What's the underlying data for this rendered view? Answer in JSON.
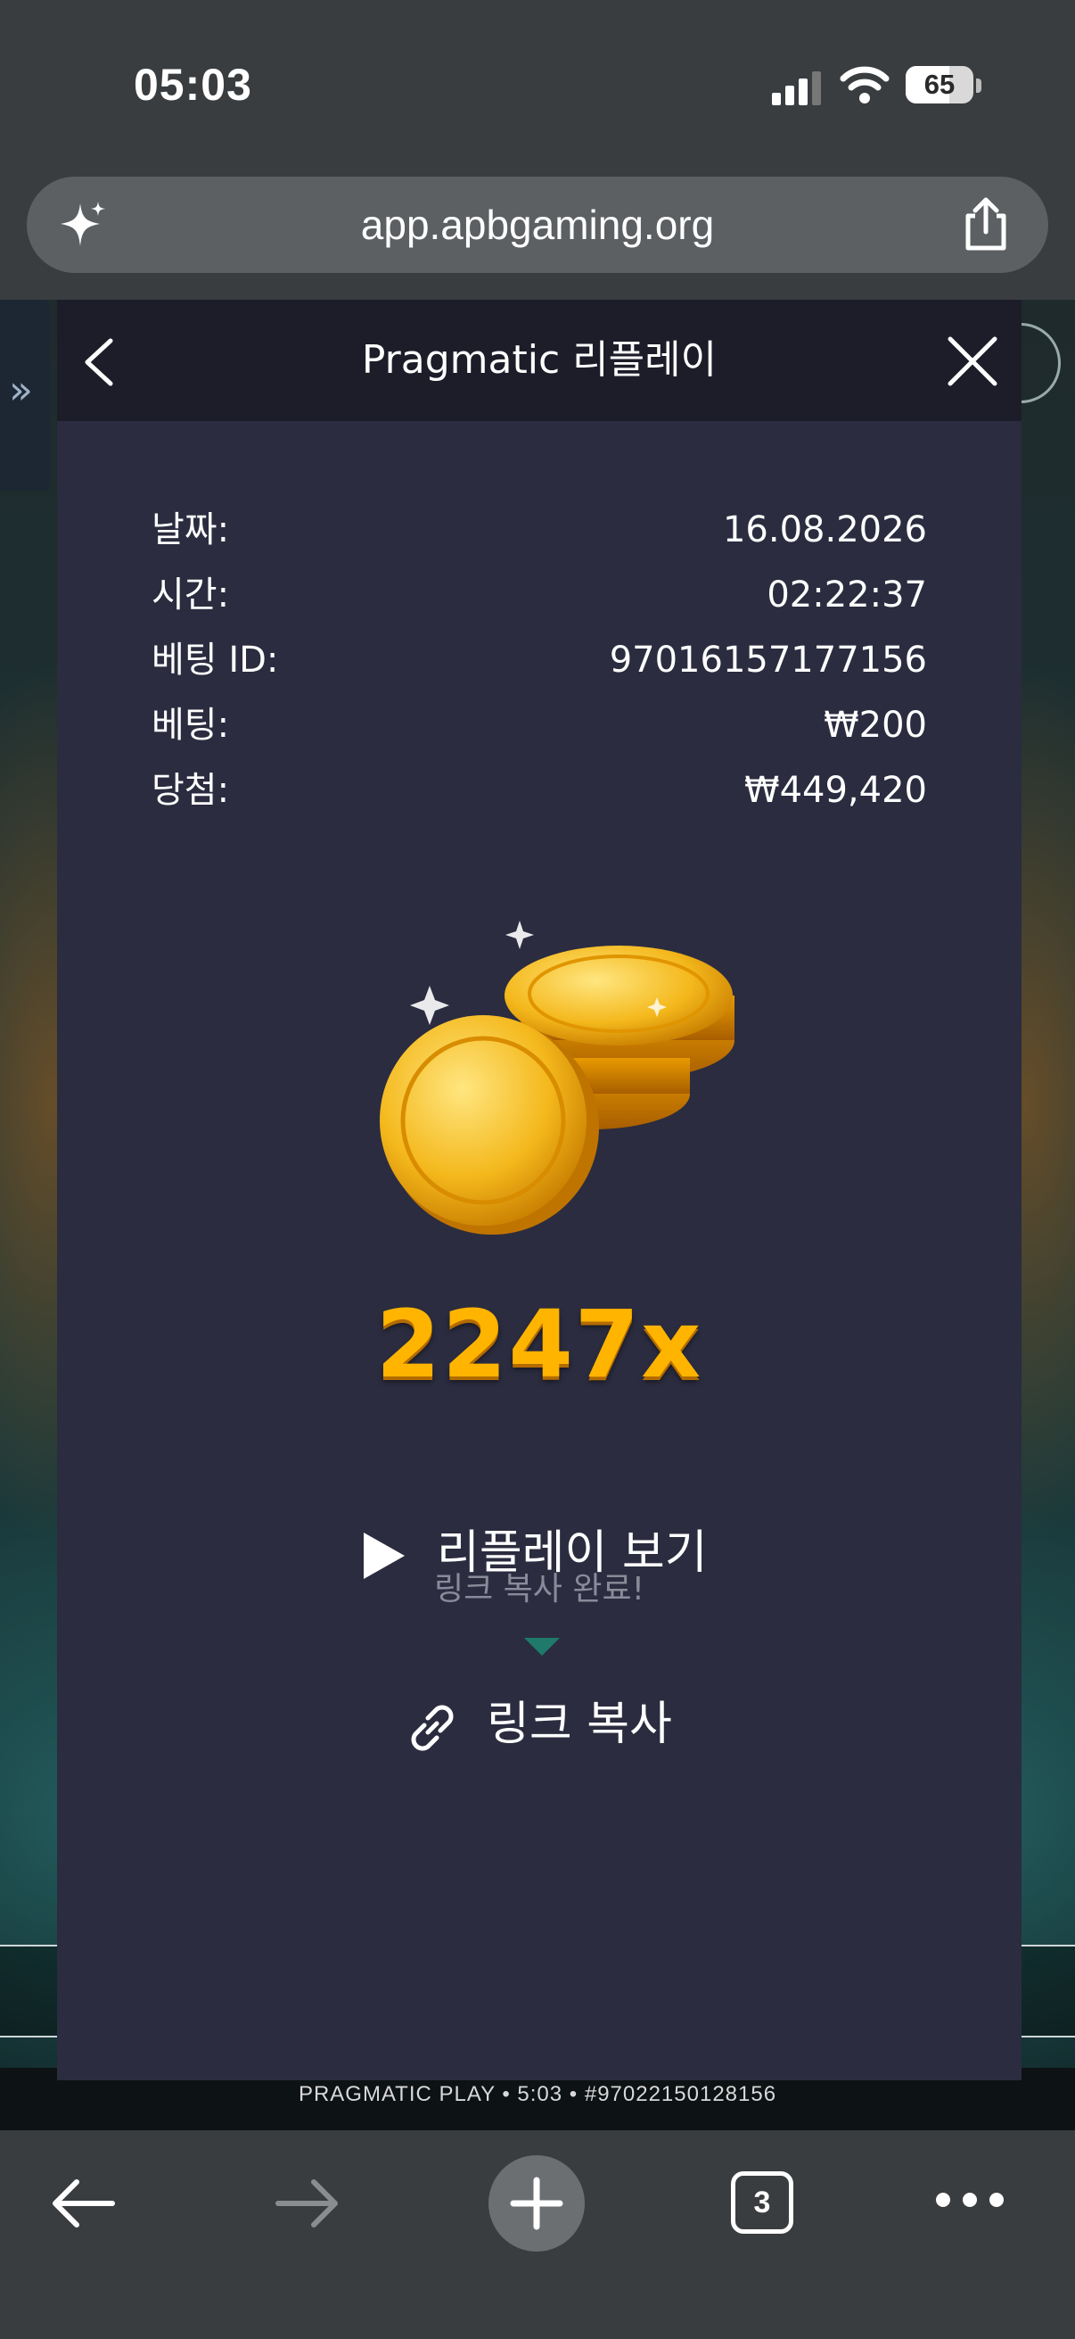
{
  "status_bar": {
    "time": "05:03",
    "battery": "65",
    "battery_level": 0.65
  },
  "browser": {
    "url": "app.apbgaming.org",
    "open_tabs": "3"
  },
  "modal": {
    "title": "Pragmatic 리플레이",
    "details": [
      {
        "label": "날짜:",
        "value": "16.08.2026"
      },
      {
        "label": "시간:",
        "value": "02:22:37"
      },
      {
        "label": "베팅 ID:",
        "value": "97016157177156"
      },
      {
        "label": "베팅:",
        "value": "₩200"
      },
      {
        "label": "당첨:",
        "value": "₩449,420"
      }
    ],
    "multiplier": "2247x",
    "replay_label": "리플레이 보기",
    "toast": "링크 복사 완료!",
    "copy_label": "링크 복사"
  },
  "game_footer": {
    "info": "PRAGMATIC PLAY • 5:03 • #97022150128156"
  },
  "colors": {
    "modal_bg": "#2b2c3f",
    "modal_header": "#1c1d29",
    "multiplier_gold": "#ffb400",
    "toast_accent": "#1f7a6b"
  }
}
